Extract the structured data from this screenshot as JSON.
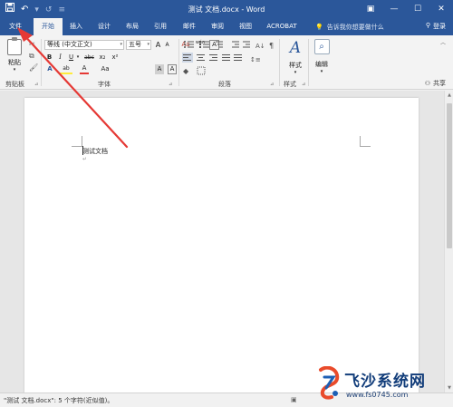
{
  "titlebar": {
    "title": "测试 文档.docx - Word",
    "save_icon": "save-icon",
    "undo_icon": "undo-icon",
    "redo_icon": "redo-icon",
    "window_controls": [
      "ribbon-display-icon",
      "minimize-icon",
      "maximize-icon",
      "close-icon"
    ]
  },
  "tabs": [
    {
      "label": "文件",
      "active": false
    },
    {
      "label": "开始",
      "active": true
    },
    {
      "label": "插入",
      "active": false
    },
    {
      "label": "设计",
      "active": false
    },
    {
      "label": "布局",
      "active": false
    },
    {
      "label": "引用",
      "active": false
    },
    {
      "label": "邮件",
      "active": false
    },
    {
      "label": "审阅",
      "active": false
    },
    {
      "label": "视图",
      "active": false
    },
    {
      "label": "ACROBAT",
      "active": false
    }
  ],
  "tellme": {
    "text": "告诉我你想要做什么"
  },
  "account": {
    "label": "登录"
  },
  "ribbon": {
    "clipboard": {
      "paste_label": "粘贴",
      "group_label": "剪贴板"
    },
    "font": {
      "font_name": "等线 (中文正文)",
      "font_size": "五号",
      "grow": "A",
      "shrink": "A",
      "clear": "Aa",
      "wen": "wén",
      "wen_box": "A",
      "bold": "B",
      "italic": "I",
      "underline": "U",
      "strike": "abc",
      "sub": "x₂",
      "sup": "x²",
      "effects": "A",
      "highlight": "ab",
      "fontcolor": "A",
      "case": "Aa",
      "char_shade": "A",
      "char_border": "A",
      "group_label": "字体"
    },
    "paragraph": {
      "group_label": "段落"
    },
    "styles": {
      "label": "样式",
      "group_label": "样式"
    },
    "editing": {
      "label": "编辑"
    },
    "share": {
      "label": "共享"
    }
  },
  "document": {
    "text": "测试文档",
    "pilcrow": "↵"
  },
  "statusbar": {
    "text": "\"测试 文档.docx\": 5 个字符(近似值)。"
  },
  "watermark": {
    "title": "飞沙系统网",
    "url": "www.fs0745.com"
  },
  "colors": {
    "brand": "#2b579a",
    "annotation_arrow": "#e53935",
    "ribbon_bg": "#f3f3f3"
  }
}
